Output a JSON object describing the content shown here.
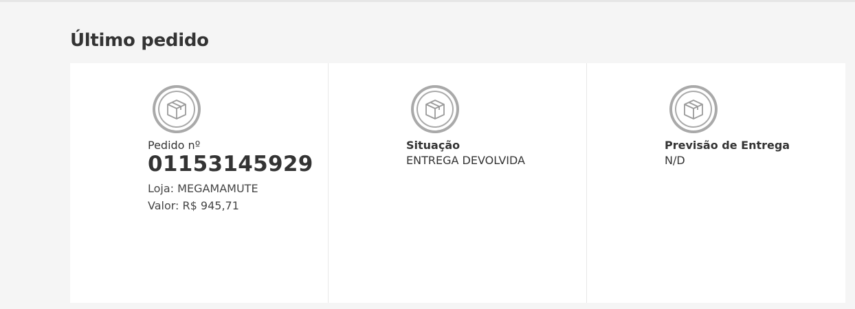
{
  "section": {
    "title": "Último pedido"
  },
  "cards": [
    {
      "icon": "package-box-icon",
      "label": "Pedido nº",
      "order_number": "01153145929",
      "store": "Loja: MEGAMAMUTE",
      "amount": "Valor: R$ 945,71"
    },
    {
      "icon": "package-box-icon",
      "label": "Situação",
      "value": "ENTREGA DEVOLVIDA"
    },
    {
      "icon": "package-box-icon",
      "label": "Previsão de Entrega",
      "value": "N/D"
    }
  ],
  "colors": {
    "background": "#f5f5f5",
    "panel": "#ffffff",
    "icon_ring": "#a9a9a9",
    "text": "#333333"
  }
}
